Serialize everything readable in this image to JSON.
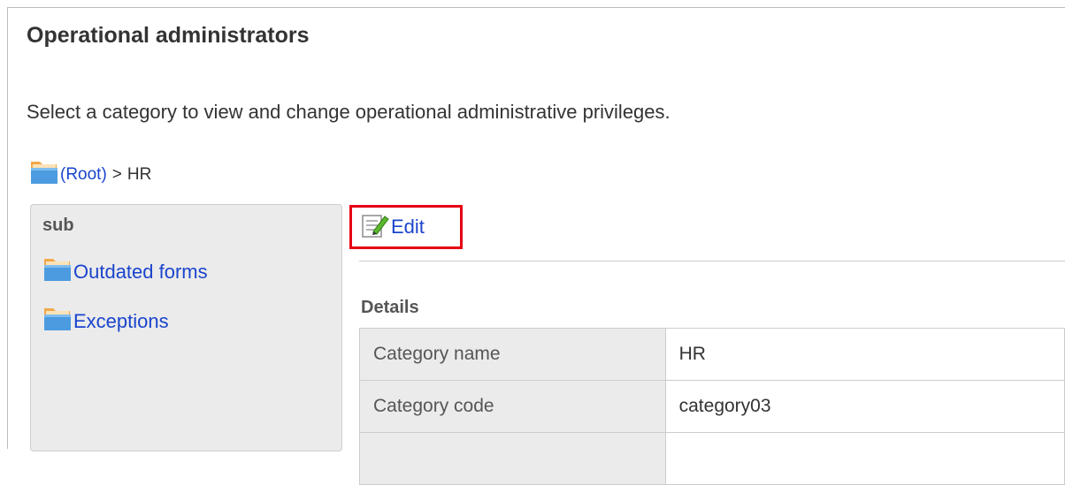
{
  "page": {
    "title": "Operational administrators",
    "description": "Select a category to view and change operational administrative privileges."
  },
  "breadcrumb": {
    "root_label": "(Root)",
    "separator": ">",
    "current": "HR"
  },
  "sidebar": {
    "header": "sub",
    "items": [
      {
        "label": "Outdated forms",
        "icon": "folder-icon"
      },
      {
        "label": "Exceptions",
        "icon": "folder-icon"
      }
    ]
  },
  "toolbar": {
    "edit_label": "Edit",
    "edit_icon": "edit-icon",
    "highlight_color": "#e60012"
  },
  "details": {
    "heading": "Details",
    "rows": [
      {
        "key": "Category name",
        "value": "HR"
      },
      {
        "key": "Category code",
        "value": "category03"
      },
      {
        "key": "",
        "value": ""
      }
    ]
  },
  "colors": {
    "link": "#1a44cc",
    "key_cell_bg": "#ebebeb",
    "sidebar_bg": "#ebebeb"
  }
}
